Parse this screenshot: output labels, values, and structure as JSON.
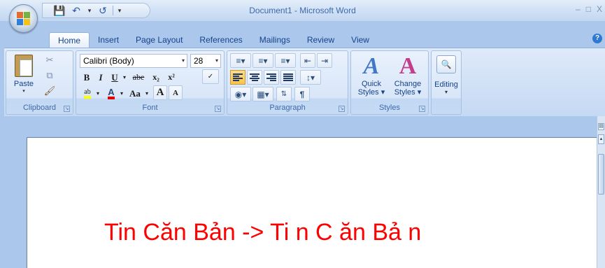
{
  "window": {
    "title": "Document1 - Microsoft Word",
    "controls": [
      "–",
      "□",
      "X"
    ]
  },
  "quick_access": {
    "items": [
      "save-icon",
      "undo-icon",
      "redo-icon",
      "customize-icon"
    ]
  },
  "tabs": [
    {
      "label": "Home",
      "active": true
    },
    {
      "label": "Insert"
    },
    {
      "label": "Page Layout"
    },
    {
      "label": "References"
    },
    {
      "label": "Mailings"
    },
    {
      "label": "Review"
    },
    {
      "label": "View"
    }
  ],
  "ribbon": {
    "clipboard": {
      "label": "Clipboard",
      "paste_label": "Paste"
    },
    "font": {
      "label": "Font",
      "font_name": "Calibri (Body)",
      "font_size": "28",
      "bold": "B",
      "italic": "I",
      "underline": "U",
      "strikethrough": "abe",
      "subscript": "x₂",
      "superscript": "x²",
      "change_case": "Aa",
      "grow_font": "A",
      "shrink_font": "A"
    },
    "paragraph": {
      "label": "Paragraph",
      "show_marks": "¶"
    },
    "styles": {
      "label": "Styles",
      "quick_styles_line1": "Quick",
      "quick_styles_line2": "Styles",
      "change_styles_line1": "Change",
      "change_styles_line2": "Styles"
    },
    "editing": {
      "label": "Editing"
    }
  },
  "document": {
    "text": "Tin Căn Bản -> Ti n C ăn Bả n",
    "text_color": "#ff0000"
  },
  "colors": {
    "ribbon_bg": "#c4d9f3",
    "workspace_bg": "#abc7ec",
    "accent": "#15428b"
  }
}
